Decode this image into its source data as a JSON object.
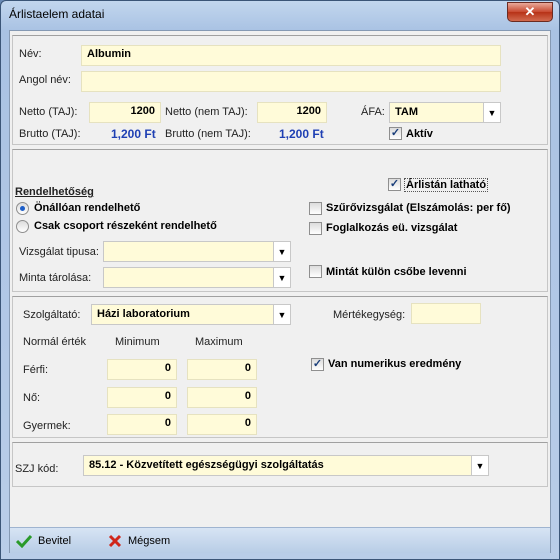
{
  "window": {
    "title": "Árlistaelem adatai"
  },
  "general": {
    "nev_label": "Név:",
    "nev_value": "Albumin",
    "angol_label": "Angol név:",
    "angol_value": "",
    "netto_taj_label": "Netto (TAJ):",
    "netto_taj_value": "1200",
    "netto_nem_taj_label": "Netto (nem TAJ):",
    "netto_nem_taj_value": "1200",
    "afa_label": "ÁFA:",
    "afa_value": "TAM",
    "brutto_taj_label": "Brutto (TAJ):",
    "brutto_taj_value": "1,200 Ft",
    "brutto_nem_taj_label": "Brutto (nem TAJ):",
    "brutto_nem_taj_value": "1,200 Ft",
    "aktiv_label": "Aktív",
    "aktiv_checked": true
  },
  "rendelhetoseg": {
    "arlistan_label": "Árlistán latható",
    "arlistan_checked": true,
    "heading": "Rendelhetőség",
    "opt_onallo": "Önállóan rendelhető",
    "opt_csoport": "Csak csoport részeként rendelhető",
    "selected": "onallo",
    "szuro_label": "Szűrővizsgálat (Elszámolás: per fő)",
    "szuro_checked": false,
    "foglalkozas_label": "Foglalkozás eü. vizsgálat",
    "foglalkozas_checked": false,
    "vizsgalat_tipus_label": "Vizsgálat tipusa:",
    "vizsgalat_tipus_value": "",
    "minta_tarolas_label": "Minta tárolása:",
    "minta_tarolas_value": "",
    "minta_kulon_label": "Mintát külön csőbe levenni",
    "minta_kulon_checked": false
  },
  "szolgaltato": {
    "label": "Szolgáltató:",
    "value": "Házi laboratorium",
    "mertekegyseg_label": "Mértékegység:",
    "mertekegyseg_value": "",
    "normal_label": "Normál érték",
    "min_label": "Minimum",
    "max_label": "Maximum",
    "ferfi_label": "Férfi:",
    "ferfi_min": "0",
    "ferfi_max": "0",
    "no_label": "Nő:",
    "no_min": "0",
    "no_max": "0",
    "gyermek_label": "Gyermek:",
    "gyermek_min": "0",
    "gyermek_max": "0",
    "numerikus_label": "Van numerikus eredmény",
    "numerikus_checked": true
  },
  "szj": {
    "label": "SZJ kód:",
    "value": "85.12 - Közvetített egészségügyi szolgáltatás"
  },
  "footer": {
    "bevitel": "Bevitel",
    "megsem": "Mégsem"
  }
}
